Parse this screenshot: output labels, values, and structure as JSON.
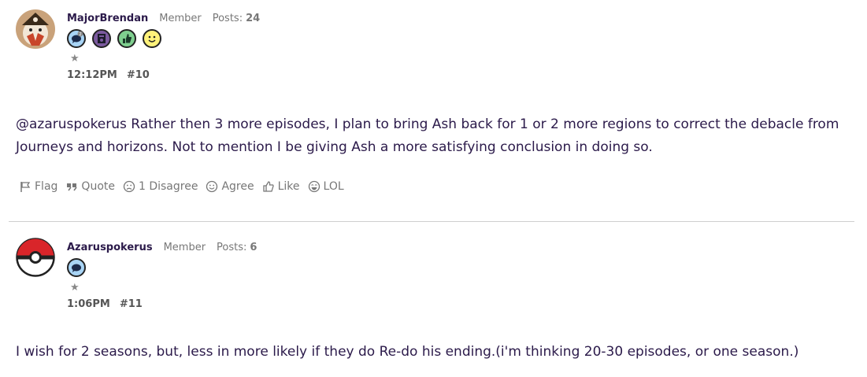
{
  "posts": [
    {
      "author": "MajorBrendan",
      "role": "Member",
      "posts_label": "Posts:",
      "posts_count": "24",
      "rank": "★",
      "time": "12:12PM",
      "number": "#10",
      "body": "@azaruspokerus Rather then 3 more episodes, I plan to bring Ash back for 1 or 2 more regions to correct the debacle from Journeys and horizons. Not to mention I be giving Ash a more satisfying conclusion in doing so.",
      "badges": [
        "comment-badge",
        "journal-badge",
        "thumbs-up-badge",
        "smiley-badge"
      ],
      "reactions": [
        {
          "label": "Flag",
          "icon": "flag-icon"
        },
        {
          "label": "Quote",
          "icon": "quote-icon"
        },
        {
          "label": "1 Disagree",
          "icon": "frown-icon"
        },
        {
          "label": "Agree",
          "icon": "smile-icon"
        },
        {
          "label": "Like",
          "icon": "thumbs-up-icon"
        },
        {
          "label": "LOL",
          "icon": "laugh-icon"
        }
      ]
    },
    {
      "author": "Azaruspokerus",
      "role": "Member",
      "posts_label": "Posts:",
      "posts_count": "6",
      "rank": "★",
      "time": "1:06PM",
      "number": "#11",
      "body": "I wish for 2 seasons, but, less in more likely if they do Re-do his ending.(i'm thinking 20-30 episodes, or one season.)",
      "badges": [
        "comment-badge"
      ]
    }
  ],
  "colors": {
    "text": "#2b1a4a",
    "muted": "#777777",
    "badge_blue": "#a8d4f5",
    "badge_purple": "#7b5a9e",
    "badge_green": "#7fcf8f",
    "badge_yellow": "#fff27a"
  }
}
